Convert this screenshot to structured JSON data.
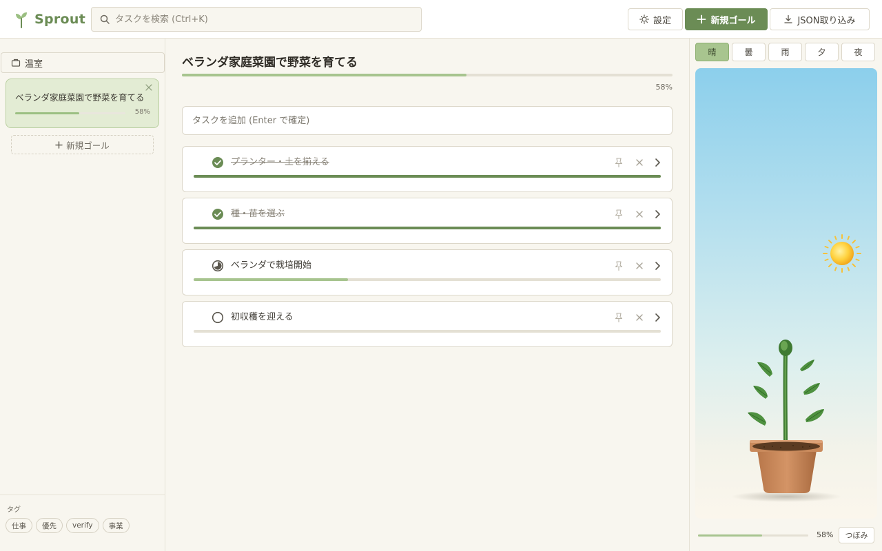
{
  "app": {
    "name": "Sprout"
  },
  "colors": {
    "accent": "#6b8c55",
    "progress": "#a7c48f",
    "done": "#6b8c55",
    "background": "#f8f6ef"
  },
  "header": {
    "search_placeholder": "タスクを検索 (Ctrl+K)",
    "settings_label": "設定",
    "new_goal_label": "新規ゴール",
    "import_label": "JSON取り込み"
  },
  "sidebar": {
    "section_label": "温室",
    "goals": [
      {
        "title": "ベランダ家庭菜園で野菜を育てる",
        "progress": 0.58,
        "percent_text": "58%"
      }
    ],
    "new_goal_label": "新規ゴール",
    "tags_label": "タグ",
    "tags": [
      "仕事",
      "優先",
      "verify",
      "事業"
    ]
  },
  "main": {
    "goal_title": "ベランダ家庭菜園で野菜を育てる",
    "goal_progress": 0.58,
    "goal_percent_text": "58%",
    "task_input_placeholder": "タスクを追加 (Enter で確定)",
    "tasks": [
      {
        "label": "プランター・土を揃える",
        "status": "done",
        "status_icon": "check-circle-icon",
        "progress": 1.0
      },
      {
        "label": "種・苗を選ぶ",
        "status": "done",
        "status_icon": "check-circle-icon",
        "progress": 1.0
      },
      {
        "label": "ベランダで栽培開始",
        "status": "in-progress",
        "status_icon": "partial-circle-icon",
        "progress": 0.33
      },
      {
        "label": "初収穫を迎える",
        "status": "todo",
        "status_icon": "empty-circle-icon",
        "progress": 0.0
      }
    ]
  },
  "right_panel": {
    "weather_tabs": [
      "晴",
      "曇",
      "雨",
      "夕",
      "夜"
    ],
    "active_weather": "晴",
    "growth_progress": 0.58,
    "growth_percent_text": "58%",
    "stage_label": "つぼみ"
  }
}
